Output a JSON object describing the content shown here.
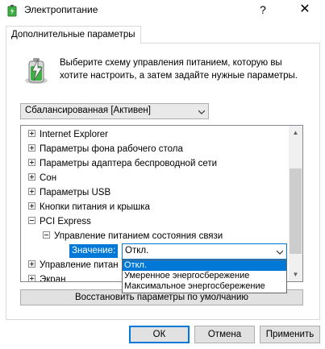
{
  "window": {
    "title": "Электропитание",
    "help_glyph": "?",
    "close_glyph": "✕"
  },
  "tab_label": "Дополнительные параметры",
  "description": "Выберите схему управления питанием, которую вы хотите настроить, а затем задайте нужные параметры.",
  "plan_select": {
    "value": "Сбалансированная [Активен]"
  },
  "tree": {
    "items": [
      {
        "label": "Internet Explorer",
        "expanded": false
      },
      {
        "label": "Параметры фона рабочего стола",
        "expanded": false
      },
      {
        "label": "Параметры адаптера беспроводной сети",
        "expanded": false
      },
      {
        "label": "Сон",
        "expanded": false
      },
      {
        "label": "Параметры USB",
        "expanded": false
      },
      {
        "label": "Кнопки питания и крышка",
        "expanded": false
      },
      {
        "label": "PCI Express",
        "expanded": true
      },
      {
        "label": "Управление питанием состояния связи",
        "expanded": true
      },
      {
        "label": "Управление питан",
        "expanded": false
      },
      {
        "label": "Экран",
        "expanded": false
      }
    ],
    "value_label": "Значение:",
    "value_selected": "Откл.",
    "options": [
      "Откл.",
      "Умеренное энергосбережение",
      "Максимальное энергосбережение"
    ]
  },
  "restore_button": "Восстановить параметры по умолчанию",
  "buttons": {
    "ok": "ОК",
    "cancel": "Отмена",
    "apply": "Применить"
  },
  "colors": {
    "accent": "#0078d7",
    "battery_green": "#3cb043"
  }
}
